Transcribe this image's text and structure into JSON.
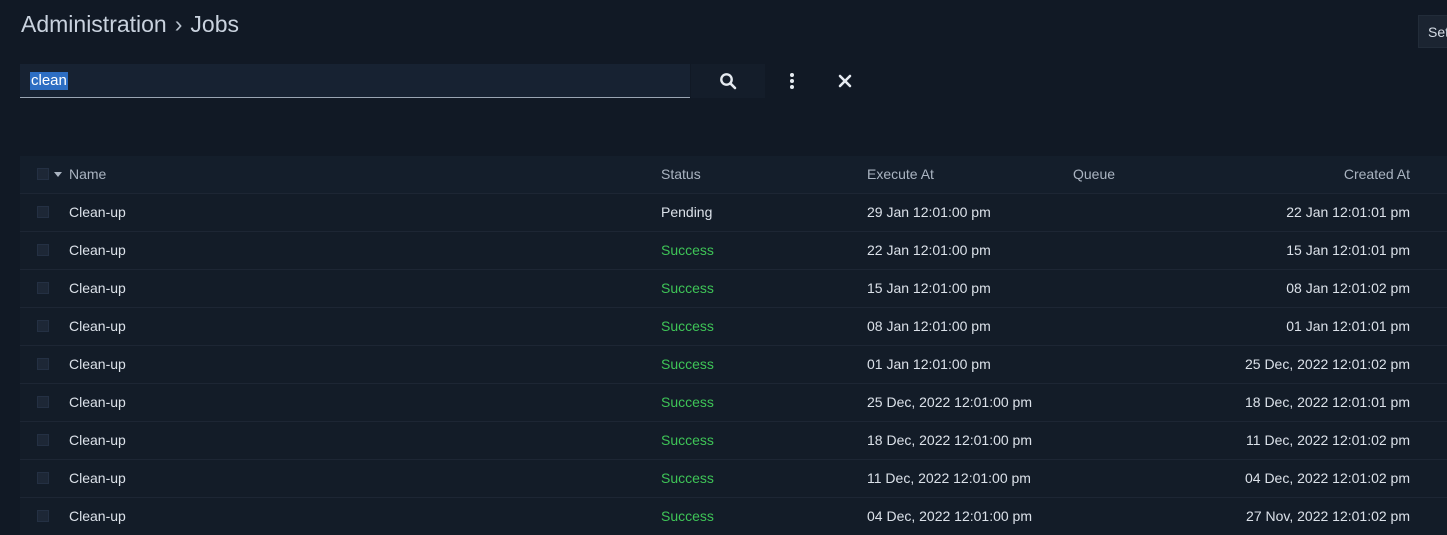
{
  "breadcrumb": {
    "parent": "Administration",
    "separator": "›",
    "current": "Jobs"
  },
  "top_right_button": {
    "label": "Set"
  },
  "search": {
    "value": "clean"
  },
  "icons": {
    "search": "search-icon",
    "more": "kebab-menu-icon",
    "clear": "close-icon"
  },
  "table": {
    "columns": {
      "name": "Name",
      "status": "Status",
      "execute_at": "Execute At",
      "queue": "Queue",
      "created_at": "Created At"
    },
    "rows": [
      {
        "name": "Clean-up",
        "status": "Pending",
        "execute_at": "29 Jan 12:01:00 pm",
        "queue": "",
        "created_at": "22 Jan 12:01:01 pm"
      },
      {
        "name": "Clean-up",
        "status": "Success",
        "execute_at": "22 Jan 12:01:00 pm",
        "queue": "",
        "created_at": "15 Jan 12:01:01 pm"
      },
      {
        "name": "Clean-up",
        "status": "Success",
        "execute_at": "15 Jan 12:01:00 pm",
        "queue": "",
        "created_at": "08 Jan 12:01:02 pm"
      },
      {
        "name": "Clean-up",
        "status": "Success",
        "execute_at": "08 Jan 12:01:00 pm",
        "queue": "",
        "created_at": "01 Jan 12:01:01 pm"
      },
      {
        "name": "Clean-up",
        "status": "Success",
        "execute_at": "01 Jan 12:01:00 pm",
        "queue": "",
        "created_at": "25 Dec, 2022 12:01:02 pm"
      },
      {
        "name": "Clean-up",
        "status": "Success",
        "execute_at": "25 Dec, 2022 12:01:00 pm",
        "queue": "",
        "created_at": "18 Dec, 2022 12:01:01 pm"
      },
      {
        "name": "Clean-up",
        "status": "Success",
        "execute_at": "18 Dec, 2022 12:01:00 pm",
        "queue": "",
        "created_at": "11 Dec, 2022 12:01:02 pm"
      },
      {
        "name": "Clean-up",
        "status": "Success",
        "execute_at": "11 Dec, 2022 12:01:00 pm",
        "queue": "",
        "created_at": "04 Dec, 2022 12:01:02 pm"
      },
      {
        "name": "Clean-up",
        "status": "Success",
        "execute_at": "04 Dec, 2022 12:01:00 pm",
        "queue": "",
        "created_at": "27 Nov, 2022 12:01:02 pm"
      }
    ]
  },
  "colors": {
    "background": "#111925",
    "success": "#3ec457",
    "selection": "#2d6ec3"
  }
}
